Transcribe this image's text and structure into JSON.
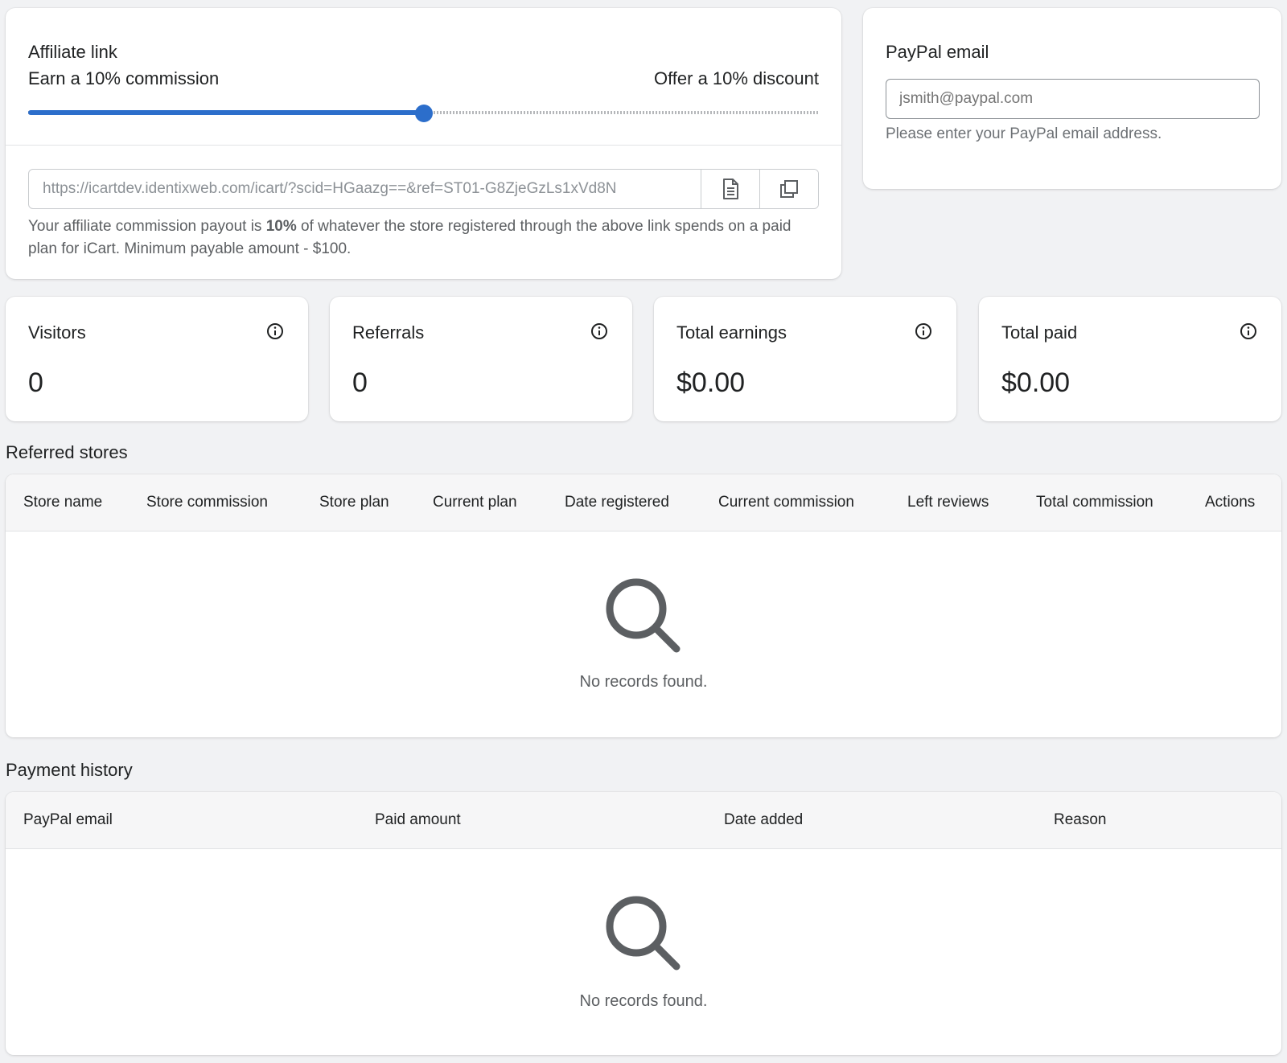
{
  "affiliate": {
    "title": "Affiliate link",
    "commission_label": "Earn a 10% commission",
    "discount_label": "Offer a 10% discount",
    "slider_position": 0.5,
    "link_url": "https://icartdev.identixweb.com/icart/?scid=HGaazg==&ref=ST01-G8ZjeGzLs1xVd8N",
    "help_prefix": "Your affiliate commission payout is ",
    "help_bold": "10%",
    "help_suffix": " of whatever the store registered through the above link spends on a paid plan for iCart. Minimum payable amount - $100.",
    "view_icon": "document-icon",
    "copy_icon": "copy-icon",
    "accent_color": "#2c6ecb"
  },
  "paypal": {
    "title": "PayPal email",
    "placeholder": "jsmith@paypal.com",
    "help": "Please enter your PayPal email address."
  },
  "stats": [
    {
      "label": "Visitors",
      "value": "0",
      "icon": "info-icon"
    },
    {
      "label": "Referrals",
      "value": "0",
      "icon": "info-icon"
    },
    {
      "label": "Total earnings",
      "value": "$0.00",
      "icon": "info-icon"
    },
    {
      "label": "Total paid",
      "value": "$0.00",
      "icon": "info-icon"
    }
  ],
  "referred_stores": {
    "heading": "Referred stores",
    "columns": [
      "Store name",
      "Store commission",
      "Store plan",
      "Current plan",
      "Date registered",
      "Current commission",
      "Left reviews",
      "Total commission",
      "Actions"
    ],
    "empty_text": "No records found.",
    "empty_icon": "search-icon"
  },
  "payment_history": {
    "heading": "Payment history",
    "columns": [
      "PayPal email",
      "Paid amount",
      "Date added",
      "Reason"
    ],
    "empty_text": "No records found.",
    "empty_icon": "search-icon"
  }
}
